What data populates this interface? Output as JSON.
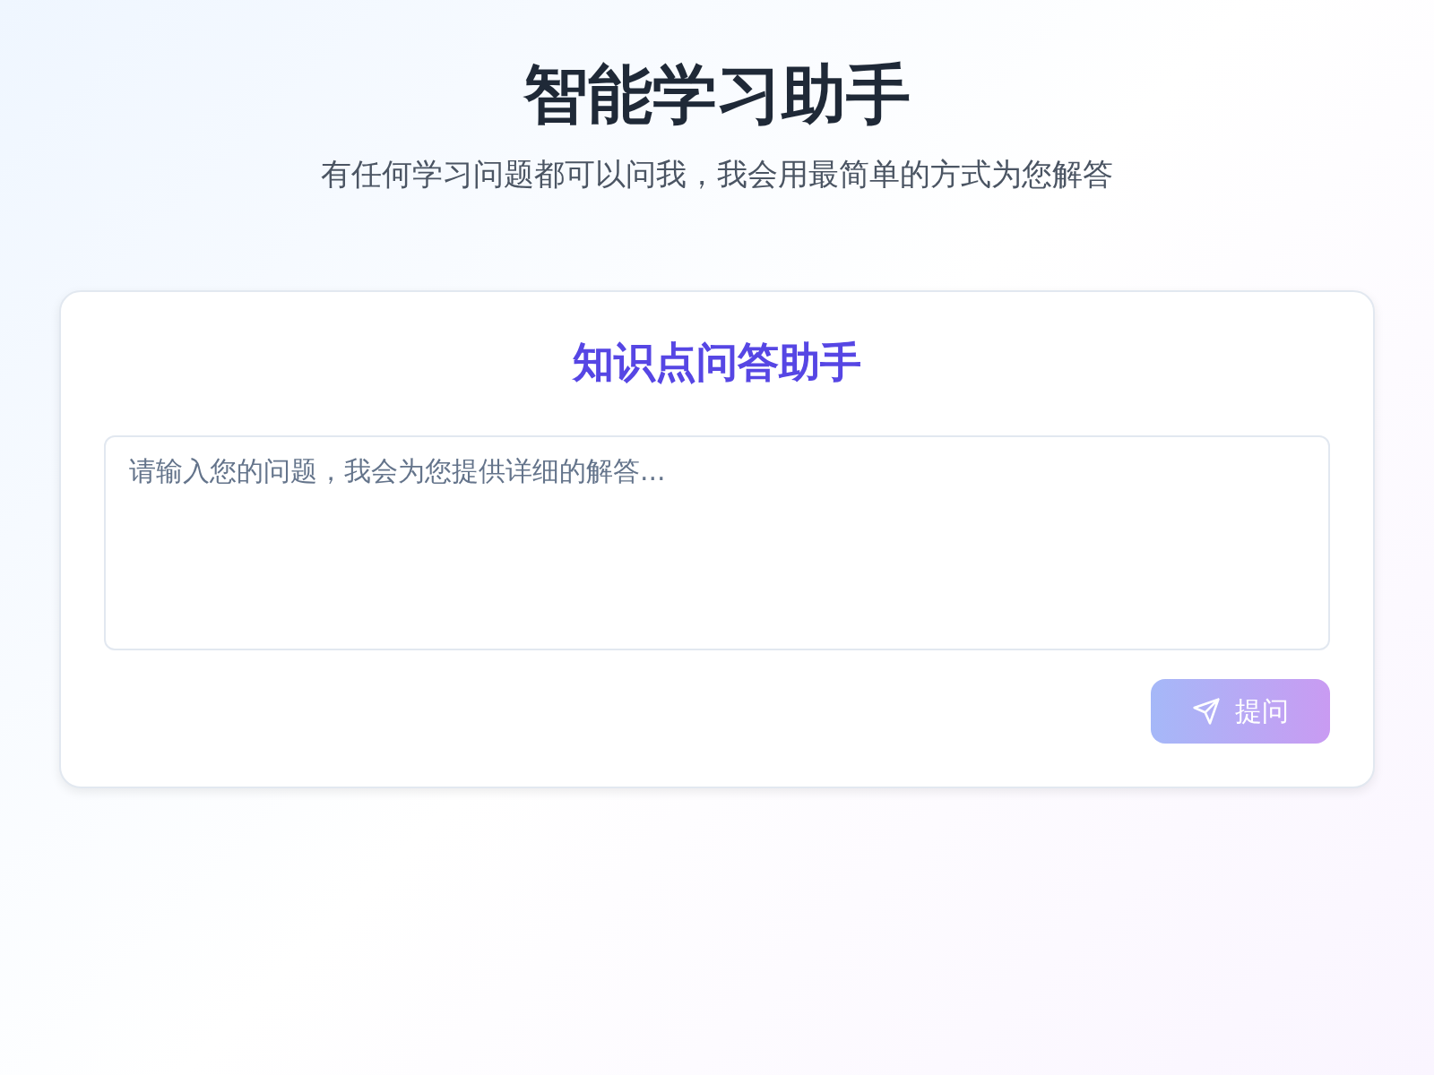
{
  "header": {
    "title": "智能学习助手",
    "subtitle": "有任何学习问题都可以问我，我会用最简单的方式为您解答"
  },
  "card": {
    "title": "知识点问答助手",
    "question": {
      "placeholder": "请输入您的问题，我会为您提供详细的解答..."
    },
    "submit": {
      "label": "提问",
      "disabled": true
    }
  }
}
